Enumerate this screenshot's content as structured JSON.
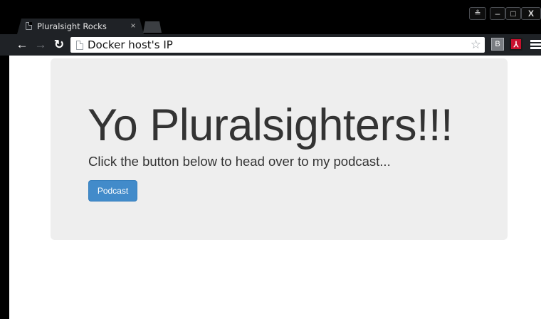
{
  "browser": {
    "tab": {
      "title": "Pluralsight Rocks",
      "close_glyph": "×"
    },
    "window_controls": {
      "user_glyph": "≗",
      "minimize_glyph": "–",
      "maximize_glyph": "□",
      "close_glyph": "X"
    },
    "nav": {
      "back_glyph": "←",
      "forward_glyph": "→",
      "reload_glyph": "↻"
    },
    "omnibox": {
      "url": "Docker host's IP",
      "star_glyph": "☆"
    },
    "extensions": {
      "ext1_glyph": "B",
      "ext2_glyph": "⅄"
    },
    "colors": {
      "chrome_frame": "#000000",
      "toolbar": "#1f2226"
    }
  },
  "page": {
    "heading": "Yo Pluralsighters!!!",
    "subtext": "Click the button below to head over to my podcast...",
    "button_label": "Podcast",
    "colors": {
      "jumbotron": "#eeeeee",
      "button": "#428bca",
      "text": "#333333"
    }
  }
}
